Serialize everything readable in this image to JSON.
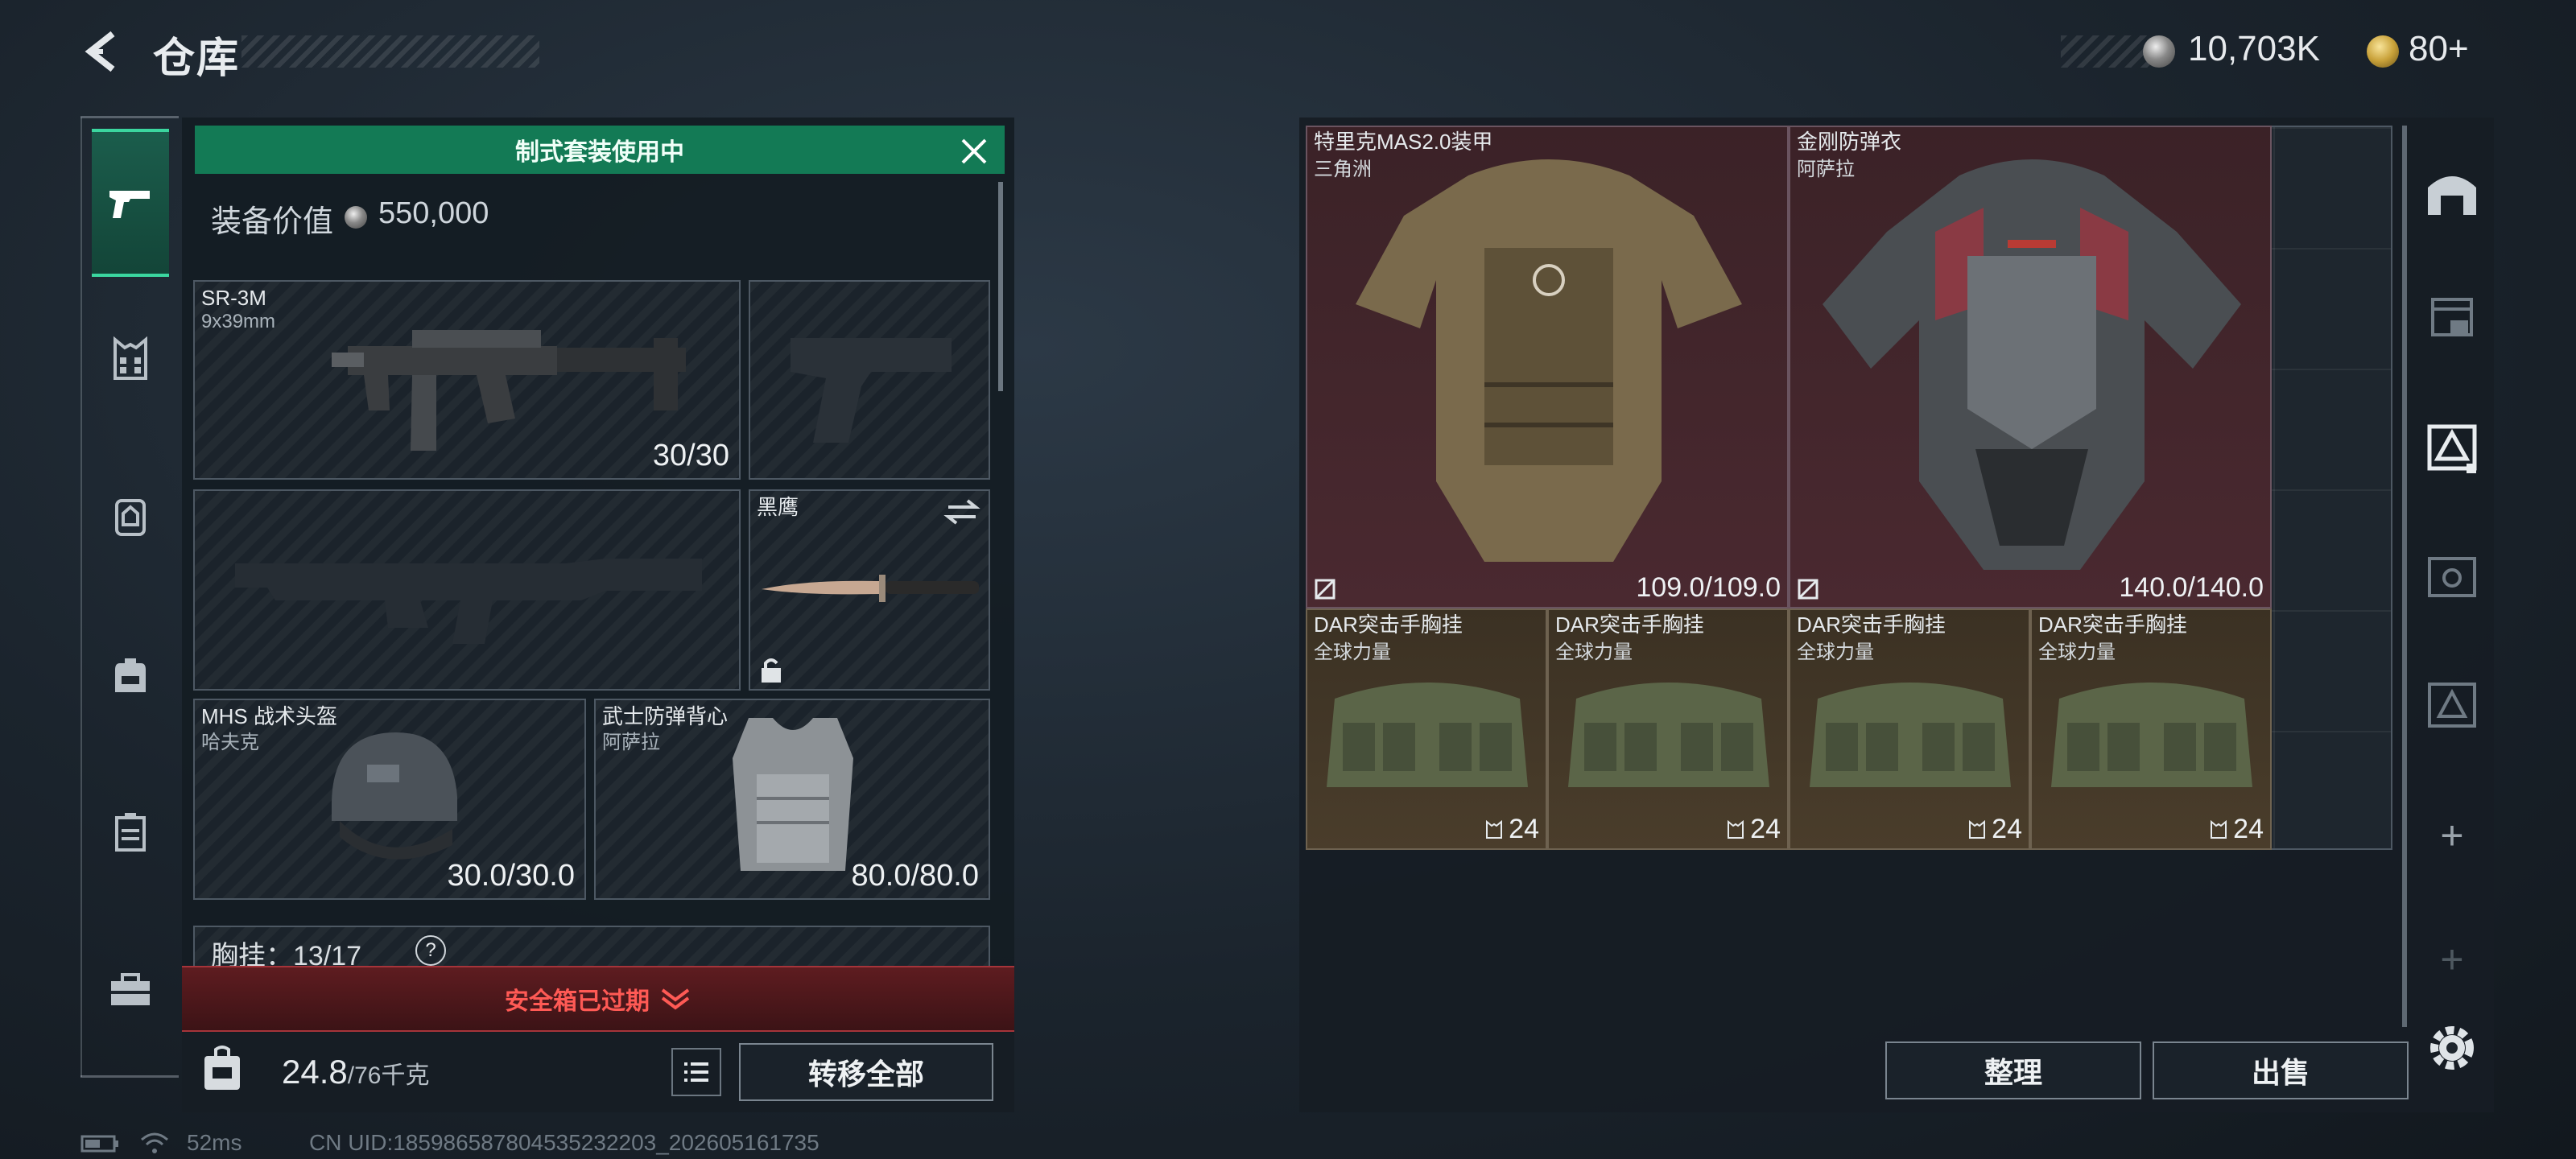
{
  "header": {
    "title": "仓库",
    "currency_silver": "10,703K",
    "currency_gold": "80+"
  },
  "loadout": {
    "banner": "制式套装使用中",
    "value_label": "装备价值",
    "value": "550,000",
    "primary": {
      "name": "SR-3M",
      "sub": "9x39mm",
      "count": "30/30"
    },
    "knife": {
      "name": "黑鹰"
    },
    "helmet": {
      "name": "MHS 战术头盔",
      "sub": "哈夫克",
      "durability": "30.0/30.0"
    },
    "armor": {
      "name": "武士防弹背心",
      "sub": "阿萨拉",
      "durability": "80.0/80.0"
    },
    "chest_label": "胸挂：",
    "chest_count": "13/17",
    "chest_help": "?",
    "safe_box": "安全箱已过期",
    "weight": "24.8",
    "weight_max": "/76千克",
    "transfer_all": "转移全部"
  },
  "storage": {
    "items": [
      {
        "name": "特里克MAS2.0装甲",
        "sub": "三角洲",
        "value": "109.0/109.0"
      },
      {
        "name": "金刚防弹衣",
        "sub": "阿萨拉",
        "value": "140.0/140.0"
      },
      {
        "name": "DAR突击手胸挂",
        "sub": "全球力量",
        "value": "24"
      },
      {
        "name": "DAR突击手胸挂",
        "sub": "全球力量",
        "value": "24"
      },
      {
        "name": "DAR突击手胸挂",
        "sub": "全球力量",
        "value": "24"
      },
      {
        "name": "DAR突击手胸挂",
        "sub": "全球力量",
        "value": "24"
      }
    ],
    "sort_label": "整理",
    "sell_label": "出售",
    "plus_label": "+"
  },
  "status": {
    "ping": "52ms",
    "uid": "CN UID:18598658780453523​2203_202605161735"
  }
}
